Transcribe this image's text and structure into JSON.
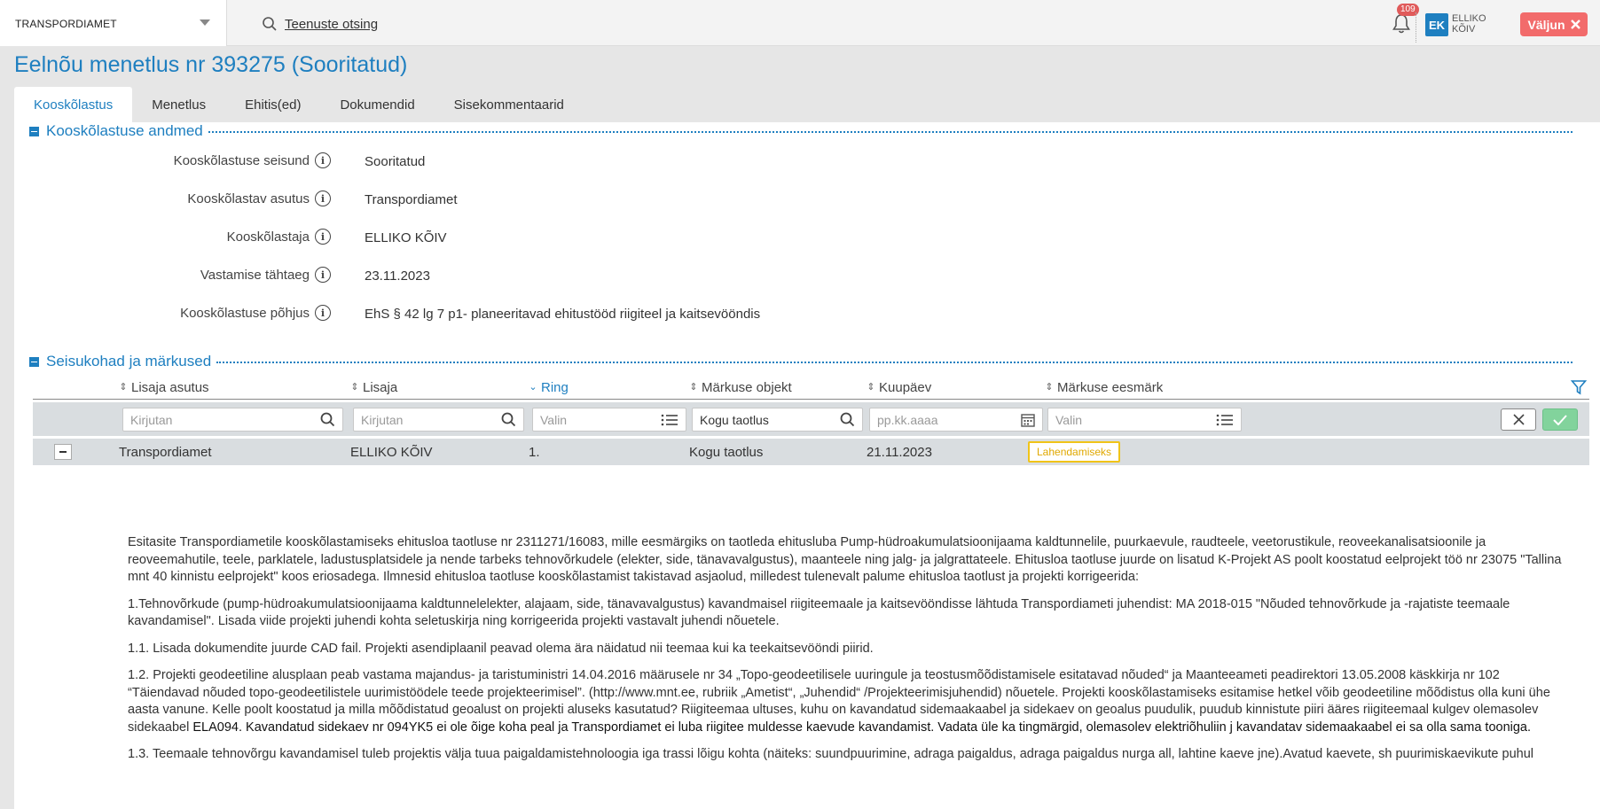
{
  "topbar": {
    "org": "TRANSPORDIAMET",
    "search_label": "Teenuste otsing",
    "notifications_count": "109",
    "user_initials": "EK",
    "user_name_line1": "ELLIKO",
    "user_name_line2": "KÕIV",
    "logout_label": "Väljun"
  },
  "page": {
    "title": "Eelnõu menetlus nr 393275 (Sooritatud)"
  },
  "tabs": [
    {
      "label": "Kooskõlastus",
      "active": true
    },
    {
      "label": "Menetlus"
    },
    {
      "label": "Ehitis(ed)"
    },
    {
      "label": "Dokumendid"
    },
    {
      "label": "Sisekommentaarid"
    }
  ],
  "section1": {
    "title": "Kooskõlastuse andmed",
    "fields": [
      {
        "label": "Kooskõlastuse seisund",
        "value": "Sooritatud"
      },
      {
        "label": "Kooskõlastav asutus",
        "value": "Transpordiamet"
      },
      {
        "label": "Kooskõlastaja",
        "value": "ELLIKO KÕIV"
      },
      {
        "label": "Vastamise tähtaeg",
        "value": "23.11.2023"
      },
      {
        "label": "Kooskõlastuse põhjus",
        "value": "EhS § 42 lg 7 p1- planeeritavad ehitustööd riigiteel ja kaitsevööndis"
      }
    ]
  },
  "section2": {
    "title": "Seisukohad ja märkused",
    "columns": [
      "Lisaja asutus",
      "Lisaja",
      "Ring",
      "Märkuse objekt",
      "Kuupäev",
      "Märkuse eesmärk"
    ],
    "filters": {
      "f1_placeholder": "Kirjutan",
      "f2_placeholder": "Kirjutan",
      "f3_placeholder": "Valin",
      "f4_value": "Kogu taotlus",
      "f5_placeholder": "pp.kk.aaaa",
      "f6_placeholder": "Valin"
    },
    "row": {
      "asutus": "Transpordiamet",
      "lisaja": "ELLIKO KÕIV",
      "ring": "1.",
      "objekt": "Kogu taotlus",
      "kuupaev": "21.11.2023",
      "eesmark": "Lahendamiseks"
    },
    "text": {
      "p1": "Esitasite Transpordiametile kooskõlastamiseks ehitusloa taotluse nr 2311271/16083, mille eesmärgiks on taotleda ehitusluba Pump-hüdroakumulatsioonijaama kaldtunnelile, puurkaevule, raudteele, veetorustikule, reoveekanalisatsioonile ja reoveemahutile, teele, parklatele, ladustusplatsidele ja nende tarbeks tehnovõrkudele (elekter, side, tänavavalgustus), maanteele ning jalg- ja jalgrattateele. Ehitusloa taotluse juurde on lisatud K-Projekt AS poolt koostatud eelprojekt töö nr 23075 \"Tallina mnt 40 kinnistu eelprojekt\" koos eriosadega. Ilmnesid ehitusloa taotluse kooskõlastamist takistavad asjaolud, milledest tulenevalt palume ehitusloa taotlust ja projekti korrigeerida:",
      "p2": "1.Tehnovõrkude (pump-hüdroakumulatsioonijaama kaldtunnelelekter, alajaam, side, tänavavalgustus) kavandmaisel riigiteemaale ja kaitsevööndisse lähtuda Transpordiameti juhendist: MA 2018-015 \"Nõuded tehnovõrkude ja -rajatiste teemaale kavandamisel\". Lisada viide projekti juhendi kohta seletuskirja ning korrigeerida projekti vastavalt juhendi nõuetele.",
      "p3": "1.1. Lisada dokumendite juurde CAD fail. Projekti asendiplaanil peavad olema ära näidatud nii teemaa kui ka teekaitsevööndi piirid.",
      "p4a": "1.2. Projekti geodeetiline alusplaan peab vastama majandus- ja taristuministri 14.04.2016 määrusele nr 34 „Topo-geodeetilisele uuringule ja teostusmõõdistamisele esitatavad nõuded“ ja Maanteeameti peadirektori 13.05.2008 käskkirja nr 102 “Täiendavad nõuded topo-geodeetilistele uurimistöödele teede projekteerimisel”. (http://www.mnt.ee, rubriik „Ametist“, „Juhendid“ /Projekteerimisjuhendid) nõuetele. Projekti kooskõlastamiseks esitamise hetkel võib geodeetiline mõõdistus olla kuni ühe aasta vanune. Kelle poolt koostatud ja milla mõõdistatud geoalust on projekti aluseks kasutatud? Riigiteemaa ultuses, kuhu on kavandatud sidemaakaabel ja sidekaev on geoalus puudulik, puudub kinnistute piiri ääres riigiteemaal kulgev olemasolev sidekaabel ",
      "p4b": "ELA094. Kavandatud sidekaev nr 094YK5 ei ole õige koha peal ja Transpordiamet ei luba riigitee muldesse kaevude kavandamist. Vadata üle ka tingmärgid, olemasolev elektriõhuliin j kavandatav sidemaakaabel ei sa olla sama tooniga.",
      "p5": "1.3. Teemaale tehnovõrgu kavandamisel tuleb projektis välja tuua paigaldamistehnoloogia iga trassi lõigu kohta (näiteks: suundpuurimine, adraga paigaldus, adraga paigaldus nurga all, lahtine kaeve jne).Avatud kaevete, sh puurimiskaevikute puhul"
    }
  }
}
